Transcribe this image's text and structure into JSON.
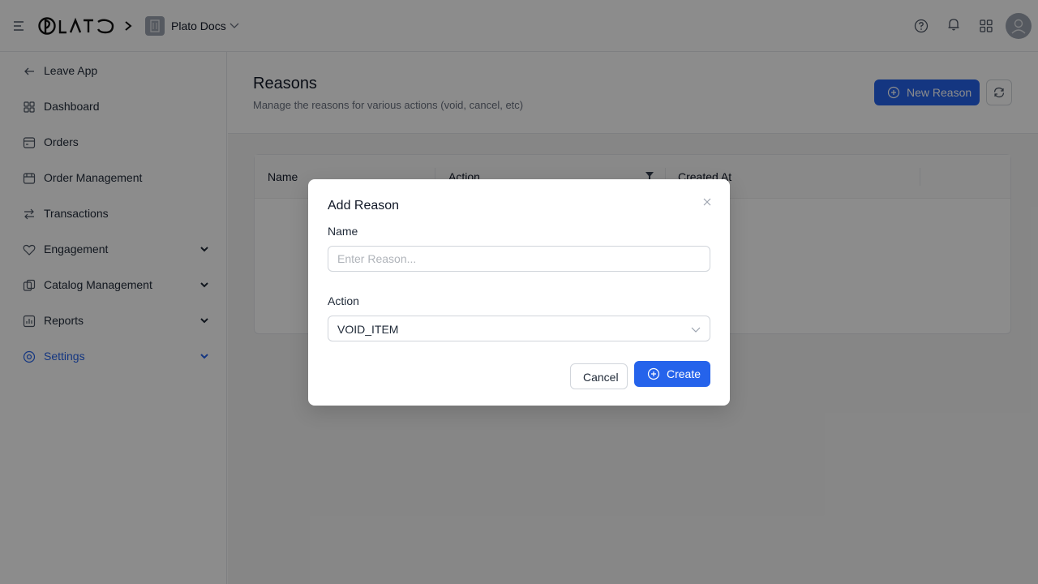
{
  "app": {
    "logo_text": "PLATO",
    "workspace": "Plato Docs"
  },
  "topbar": {
    "icons": [
      "help-icon",
      "bell-icon",
      "apps-grid-icon"
    ],
    "avatar": "user-avatar"
  },
  "sidebar": {
    "items": [
      {
        "label": "Leave App",
        "icon": "arrow-left-icon"
      },
      {
        "label": "Dashboard",
        "icon": "dashboard-icon"
      },
      {
        "label": "Orders",
        "icon": "orders-icon"
      },
      {
        "label": "Order Management",
        "icon": "order-management-icon"
      },
      {
        "label": "Transactions",
        "icon": "transactions-icon"
      },
      {
        "label": "Engagement",
        "icon": "heart-icon",
        "expandable": true
      },
      {
        "label": "Catalog Management",
        "icon": "catalog-icon",
        "expandable": true
      },
      {
        "label": "Reports",
        "icon": "reports-icon",
        "expandable": true
      },
      {
        "label": "Settings",
        "icon": "settings-icon",
        "expandable": true,
        "active": true
      }
    ]
  },
  "page": {
    "title": "Reasons",
    "subtitle": "Manage the reasons for various actions (void, cancel, etc)",
    "new_button": "New Reason"
  },
  "table": {
    "columns": [
      "Name",
      "Action",
      "Created At"
    ]
  },
  "modal": {
    "title": "Add Reason",
    "name_label": "Name",
    "name_value": "",
    "name_placeholder": "Enter Reason...",
    "action_label": "Action",
    "action_value": "VOID_ITEM",
    "cancel_label": "Cancel",
    "create_label": "Create"
  },
  "colors": {
    "primary": "#2563eb",
    "overlay": "rgba(0,0,0,0.45)"
  }
}
